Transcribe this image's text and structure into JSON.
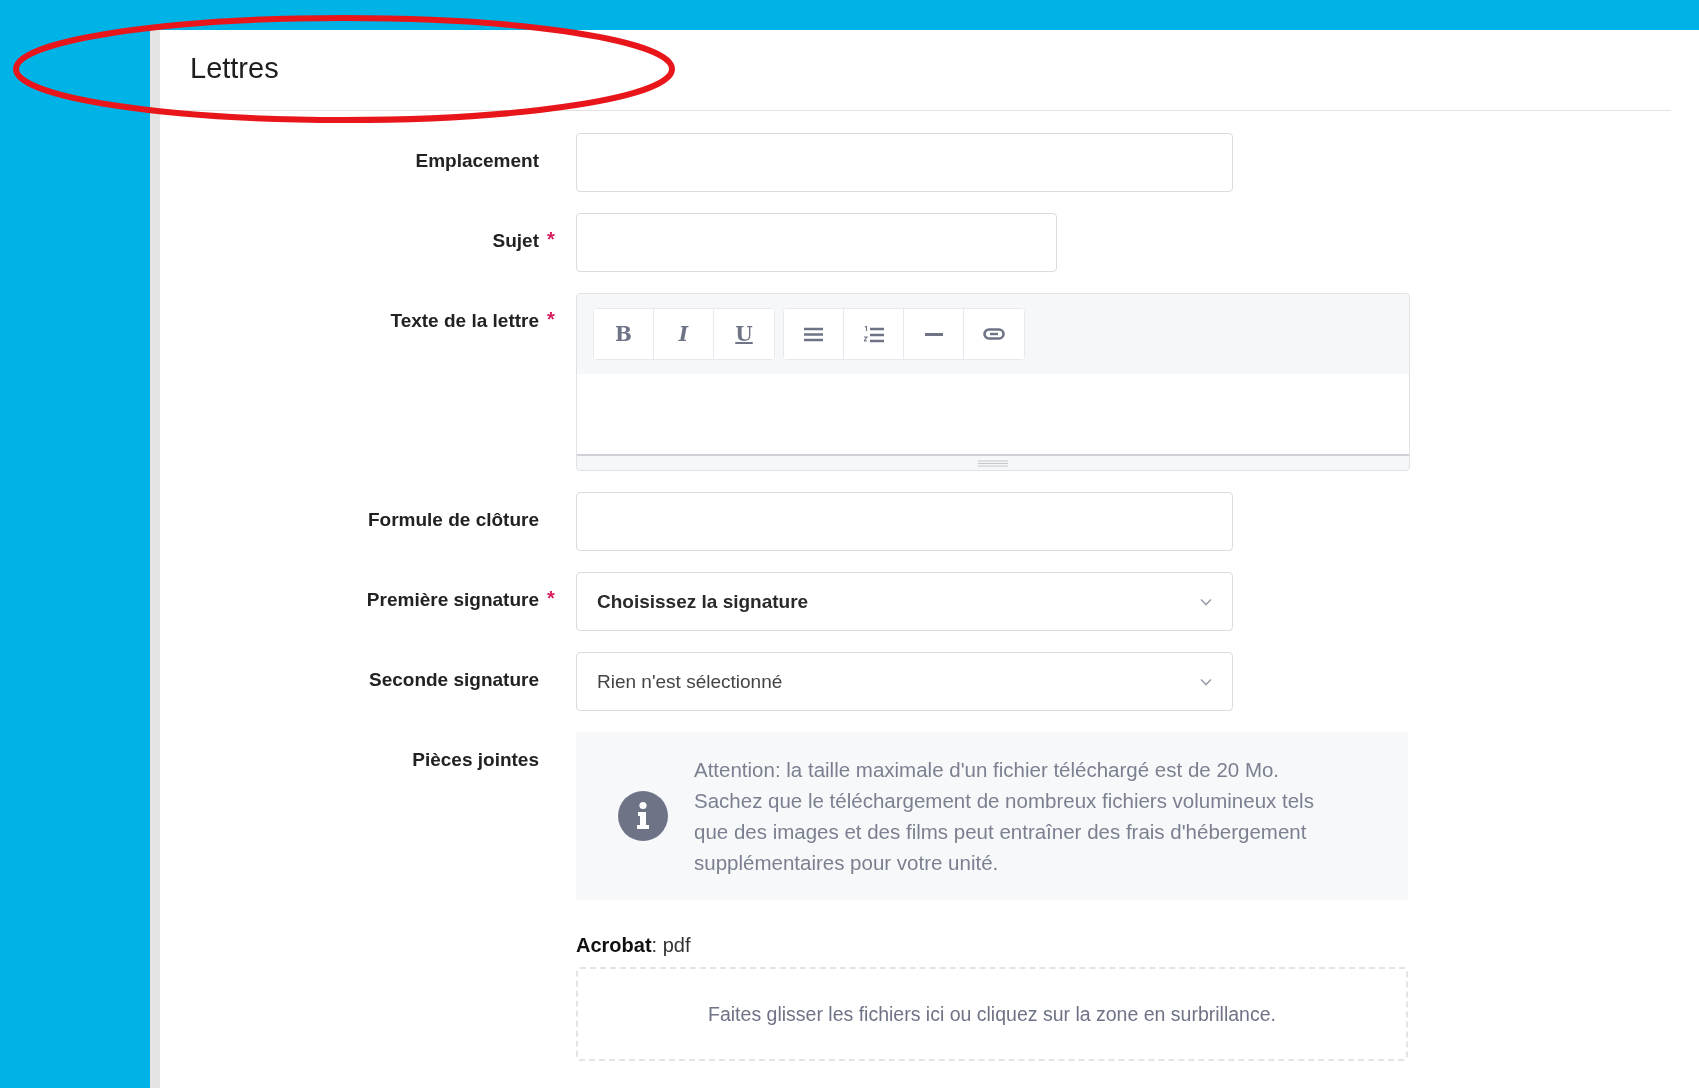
{
  "page": {
    "title": "Lettres"
  },
  "fields": [
    {
      "kind": "text",
      "label": "Emplacement"
    },
    {
      "kind": "short",
      "label": "Sujet",
      "required_mark": "*"
    },
    {
      "kind": "editor",
      "label": "Texte de la lettre",
      "required_mark": "*",
      "toolbar": [
        [
          {
            "kind": "bold",
            "glyph": "B"
          },
          {
            "kind": "italic",
            "glyph": "I"
          },
          {
            "kind": "underline",
            "glyph": "U"
          }
        ],
        [
          {
            "kind": "bullets"
          },
          {
            "kind": "numbered"
          },
          {
            "kind": "rule"
          },
          {
            "kind": "link"
          }
        ]
      ]
    },
    {
      "kind": "text",
      "label": "Formule de clôture"
    },
    {
      "kind": "select",
      "label": "Première signature",
      "required_mark": "*",
      "value": "Choisissez la signature",
      "chosen": true
    },
    {
      "kind": "select",
      "label": "Seconde signature",
      "value": "Rien n'est sélectionné",
      "chosen": false
    },
    {
      "kind": "attachments",
      "label": "Pièces jointes",
      "notice": "Attention: la taille maximale d'un fichier téléchargé est de 20 Mo. Sachez que le téléchargement de nombreux fichiers volumineux tels que des images et des films peut entraîner des frais d'hébergement supplémentaires pour votre unité.",
      "types": "**Acrobat**: pdf",
      "dropzone": "Faites glisser les fichiers ici ou cliquez sur la zone en surbrillance."
    }
  ],
  "annotation": {
    "kind": "ellipse",
    "color": "#e8161b"
  }
}
